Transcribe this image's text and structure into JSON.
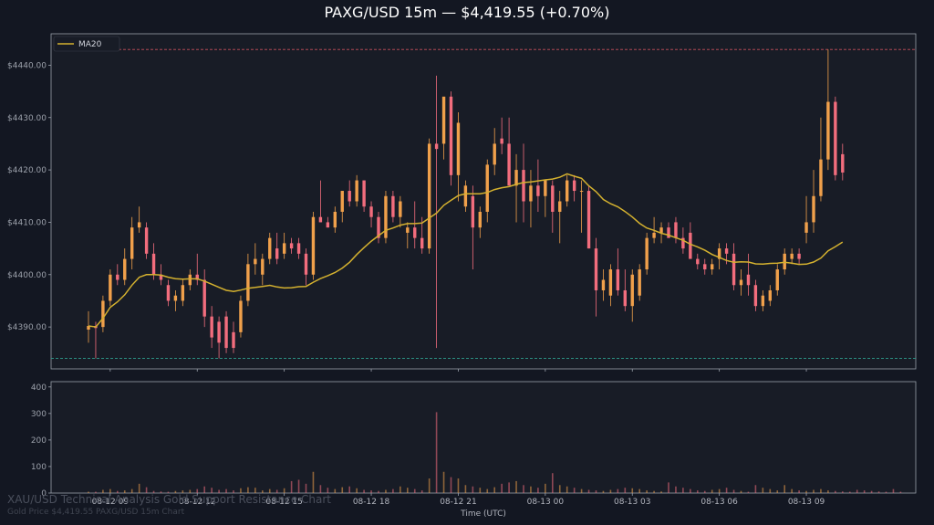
{
  "page": {
    "title": "PAXG/USD 15m — $4,419.55 (+0.70%)",
    "watermark_main": "XAU/USD Technical Analysis Gold Support Resistance Chart",
    "watermark_sub": "Gold Price $4,419.55 PAXG/USD 15m Chart"
  },
  "colors": {
    "background": "#131722",
    "up": "#f0a04b",
    "down": "#f26d7d",
    "ma": "#d4b12f",
    "resistance": "#c9505c",
    "support": "#2e9e8e",
    "grid_border": "#9aa0ab"
  },
  "chart_data": {
    "type": "candlestick",
    "title": "PAXG/USD 15m — $4,419.55 (+0.70%)",
    "xlabel": "Time (UTC)",
    "x_ticks": [
      "08-12 09",
      "08-12 12",
      "08-12 15",
      "08-12 18",
      "08-12 21",
      "08-13 00",
      "08-13 03",
      "08-13 06",
      "08-13 09"
    ],
    "price_axis": {
      "ylim": [
        4382,
        4446
      ],
      "ticks": [
        "$4390.00",
        "$4400.00",
        "$4410.00",
        "$4420.00",
        "$4430.00",
        "$4440.00"
      ]
    },
    "volume_axis": {
      "ylim": [
        0,
        420
      ],
      "ticks": [
        "0",
        "100",
        "200",
        "300",
        "400"
      ]
    },
    "legend": {
      "entries": [
        "MA20"
      ],
      "placement": "top-left"
    },
    "resistance_level": 4443.0,
    "support_level": 4384.0,
    "candles": [
      {
        "o": 4389.5,
        "h": 4393,
        "l": 4387,
        "c": 4390.2
      },
      {
        "o": 4390.2,
        "h": 4391,
        "l": 4384,
        "c": 4389.8
      },
      {
        "o": 4390,
        "h": 4396,
        "l": 4389,
        "c": 4395
      },
      {
        "o": 4395,
        "h": 4401,
        "l": 4394,
        "c": 4400
      },
      {
        "o": 4400,
        "h": 4402,
        "l": 4398,
        "c": 4399
      },
      {
        "o": 4399,
        "h": 4405,
        "l": 4398,
        "c": 4403
      },
      {
        "o": 4403,
        "h": 4411,
        "l": 4401,
        "c": 4409
      },
      {
        "o": 4409,
        "h": 4413,
        "l": 4408,
        "c": 4410
      },
      {
        "o": 4409,
        "h": 4410,
        "l": 4403,
        "c": 4404
      },
      {
        "o": 4404,
        "h": 4406,
        "l": 4399,
        "c": 4400
      },
      {
        "o": 4400,
        "h": 4402,
        "l": 4398,
        "c": 4399
      },
      {
        "o": 4398,
        "h": 4399,
        "l": 4394,
        "c": 4395
      },
      {
        "o": 4395,
        "h": 4397,
        "l": 4393,
        "c": 4396
      },
      {
        "o": 4395,
        "h": 4399,
        "l": 4394,
        "c": 4398
      },
      {
        "o": 4398,
        "h": 4401,
        "l": 4397,
        "c": 4400
      },
      {
        "o": 4400,
        "h": 4404,
        "l": 4398,
        "c": 4399
      },
      {
        "o": 4399,
        "h": 4401,
        "l": 4390,
        "c": 4392
      },
      {
        "o": 4392,
        "h": 4394,
        "l": 4386,
        "c": 4388
      },
      {
        "o": 4391,
        "h": 4392,
        "l": 4384,
        "c": 4387
      },
      {
        "o": 4392,
        "h": 4393,
        "l": 4385,
        "c": 4386
      },
      {
        "o": 4389,
        "h": 4391,
        "l": 4385,
        "c": 4386
      },
      {
        "o": 4389,
        "h": 4396,
        "l": 4388,
        "c": 4395
      },
      {
        "o": 4395,
        "h": 4404,
        "l": 4394,
        "c": 4402
      },
      {
        "o": 4402,
        "h": 4406,
        "l": 4400,
        "c": 4403
      },
      {
        "o": 4400,
        "h": 4404,
        "l": 4398,
        "c": 4403
      },
      {
        "o": 4403,
        "h": 4408,
        "l": 4402,
        "c": 4407
      },
      {
        "o": 4405,
        "h": 4408,
        "l": 4402,
        "c": 4403
      },
      {
        "o": 4404,
        "h": 4408,
        "l": 4403,
        "c": 4406
      },
      {
        "o": 4406,
        "h": 4407,
        "l": 4404,
        "c": 4405
      },
      {
        "o": 4406,
        "h": 4407,
        "l": 4403,
        "c": 4404
      },
      {
        "o": 4404,
        "h": 4405,
        "l": 4398,
        "c": 4400
      },
      {
        "o": 4400,
        "h": 4412,
        "l": 4399,
        "c": 4411
      },
      {
        "o": 4411,
        "h": 4418,
        "l": 4410,
        "c": 4410
      },
      {
        "o": 4410,
        "h": 4411,
        "l": 4409,
        "c": 4409
      },
      {
        "o": 4409,
        "h": 4413,
        "l": 4408,
        "c": 4412
      },
      {
        "o": 4412,
        "h": 4416,
        "l": 4410,
        "c": 4416
      },
      {
        "o": 4416,
        "h": 4418,
        "l": 4413,
        "c": 4414
      },
      {
        "o": 4414,
        "h": 4419,
        "l": 4413,
        "c": 4418
      },
      {
        "o": 4418,
        "h": 4418,
        "l": 4412,
        "c": 4413
      },
      {
        "o": 4413,
        "h": 4414,
        "l": 4409,
        "c": 4411
      },
      {
        "o": 4411,
        "h": 4412,
        "l": 4406,
        "c": 4407
      },
      {
        "o": 4407,
        "h": 4416,
        "l": 4406,
        "c": 4415
      },
      {
        "o": 4415,
        "h": 4416,
        "l": 4410,
        "c": 4411
      },
      {
        "o": 4411,
        "h": 4415,
        "l": 4409,
        "c": 4414
      },
      {
        "o": 4408,
        "h": 4410,
        "l": 4405,
        "c": 4409
      },
      {
        "o": 4409,
        "h": 4414,
        "l": 4405,
        "c": 4407
      },
      {
        "o": 4407,
        "h": 4411,
        "l": 4404,
        "c": 4405
      },
      {
        "o": 4405,
        "h": 4426,
        "l": 4404,
        "c": 4425
      },
      {
        "o": 4425,
        "h": 4438,
        "l": 4386,
        "c": 4424
      },
      {
        "o": 4425,
        "h": 4430,
        "l": 4422,
        "c": 4434
      },
      {
        "o": 4434,
        "h": 4435,
        "l": 4417,
        "c": 4419
      },
      {
        "o": 4419,
        "h": 4431,
        "l": 4414,
        "c": 4429
      },
      {
        "o": 4413,
        "h": 4418,
        "l": 4412,
        "c": 4417
      },
      {
        "o": 4415,
        "h": 4417,
        "l": 4401,
        "c": 4409
      },
      {
        "o": 4409,
        "h": 4413,
        "l": 4407,
        "c": 4412
      },
      {
        "o": 4412,
        "h": 4422,
        "l": 4410,
        "c": 4421
      },
      {
        "o": 4421,
        "h": 4428,
        "l": 4419,
        "c": 4425
      },
      {
        "o": 4426,
        "h": 4430,
        "l": 4423,
        "c": 4425
      },
      {
        "o": 4425,
        "h": 4430,
        "l": 4421,
        "c": 4417
      },
      {
        "o": 4417,
        "h": 4423,
        "l": 4410,
        "c": 4420
      },
      {
        "o": 4420,
        "h": 4425,
        "l": 4410,
        "c": 4414
      },
      {
        "o": 4414,
        "h": 4420,
        "l": 4409,
        "c": 4417
      },
      {
        "o": 4417,
        "h": 4422,
        "l": 4412,
        "c": 4415
      },
      {
        "o": 4415,
        "h": 4418,
        "l": 4411,
        "c": 4418
      },
      {
        "o": 4417,
        "h": 4418,
        "l": 4408,
        "c": 4412
      },
      {
        "o": 4412,
        "h": 4416,
        "l": 4406,
        "c": 4414
      },
      {
        "o": 4414,
        "h": 4419,
        "l": 4413,
        "c": 4418
      },
      {
        "o": 4418,
        "h": 4419,
        "l": 4414,
        "c": 4416
      },
      {
        "o": 4416,
        "h": 4418,
        "l": 4408,
        "c": 4416
      },
      {
        "o": 4416,
        "h": 4417,
        "l": 4405,
        "c": 4405
      },
      {
        "o": 4405,
        "h": 4407,
        "l": 4392,
        "c": 4397
      },
      {
        "o": 4397,
        "h": 4401,
        "l": 4395,
        "c": 4399
      },
      {
        "o": 4396,
        "h": 4402,
        "l": 4394,
        "c": 4401
      },
      {
        "o": 4401,
        "h": 4405,
        "l": 4396,
        "c": 4397
      },
      {
        "o": 4397,
        "h": 4401,
        "l": 4393,
        "c": 4394
      },
      {
        "o": 4394,
        "h": 4401,
        "l": 4391,
        "c": 4400
      },
      {
        "o": 4396,
        "h": 4402,
        "l": 4395,
        "c": 4401
      },
      {
        "o": 4401,
        "h": 4408,
        "l": 4400,
        "c": 4407
      },
      {
        "o": 4407,
        "h": 4411,
        "l": 4406,
        "c": 4408
      },
      {
        "o": 4408,
        "h": 4410,
        "l": 4406,
        "c": 4409
      },
      {
        "o": 4409,
        "h": 4410,
        "l": 4408,
        "c": 4407
      },
      {
        "o": 4410,
        "h": 4411,
        "l": 4406,
        "c": 4407
      },
      {
        "o": 4407,
        "h": 4409,
        "l": 4404,
        "c": 4405
      },
      {
        "o": 4408,
        "h": 4410,
        "l": 4404,
        "c": 4403
      },
      {
        "o": 4403,
        "h": 4404,
        "l": 4401,
        "c": 4402
      },
      {
        "o": 4402,
        "h": 4403,
        "l": 4400,
        "c": 4401
      },
      {
        "o": 4401,
        "h": 4403,
        "l": 4400,
        "c": 4402
      },
      {
        "o": 4403,
        "h": 4406,
        "l": 4401,
        "c": 4405
      },
      {
        "o": 4405,
        "h": 4406,
        "l": 4402,
        "c": 4404
      },
      {
        "o": 4404,
        "h": 4406,
        "l": 4397,
        "c": 4398
      },
      {
        "o": 4398,
        "h": 4401,
        "l": 4396,
        "c": 4399
      },
      {
        "o": 4400,
        "h": 4404,
        "l": 4396,
        "c": 4398
      },
      {
        "o": 4398,
        "h": 4399,
        "l": 4393,
        "c": 4394
      },
      {
        "o": 4394,
        "h": 4397,
        "l": 4393,
        "c": 4396
      },
      {
        "o": 4395,
        "h": 4398,
        "l": 4394,
        "c": 4397
      },
      {
        "o": 4397,
        "h": 4402,
        "l": 4396,
        "c": 4401
      },
      {
        "o": 4401,
        "h": 4405,
        "l": 4400,
        "c": 4404
      },
      {
        "o": 4403,
        "h": 4405,
        "l": 4402,
        "c": 4404
      },
      {
        "o": 4404,
        "h": 4405,
        "l": 4402,
        "c": 4403
      },
      {
        "o": 4408,
        "h": 4415,
        "l": 4406,
        "c": 4410
      },
      {
        "o": 4410,
        "h": 4420,
        "l": 4408,
        "c": 4415
      },
      {
        "o": 4415,
        "h": 4430,
        "l": 4414,
        "c": 4422
      },
      {
        "o": 4422,
        "h": 4443,
        "l": 4420,
        "c": 4433
      },
      {
        "o": 4433,
        "h": 4434,
        "l": 4418,
        "c": 4419
      },
      {
        "o": 4423,
        "h": 4425,
        "l": 4418,
        "c": 4419.5
      }
    ],
    "volume": [
      5,
      5,
      12,
      15,
      8,
      10,
      15,
      35,
      22,
      8,
      6,
      5,
      8,
      10,
      12,
      15,
      25,
      20,
      12,
      15,
      10,
      18,
      22,
      20,
      10,
      15,
      12,
      18,
      45,
      50,
      35,
      80,
      30,
      20,
      15,
      22,
      25,
      18,
      12,
      10,
      8,
      12,
      15,
      25,
      20,
      15,
      10,
      55,
      305,
      80,
      60,
      55,
      30,
      25,
      20,
      15,
      22,
      35,
      40,
      45,
      30,
      25,
      20,
      35,
      75,
      30,
      25,
      20,
      15,
      12,
      10,
      8,
      12,
      15,
      20,
      18,
      15,
      10,
      8,
      6,
      40,
      25,
      20,
      15,
      10,
      8,
      12,
      15,
      20,
      12,
      8,
      5,
      30,
      20,
      15,
      10,
      30,
      15,
      10,
      8,
      12,
      15,
      10,
      8,
      6,
      5,
      12,
      10,
      8,
      6,
      5,
      15,
      5
    ]
  }
}
